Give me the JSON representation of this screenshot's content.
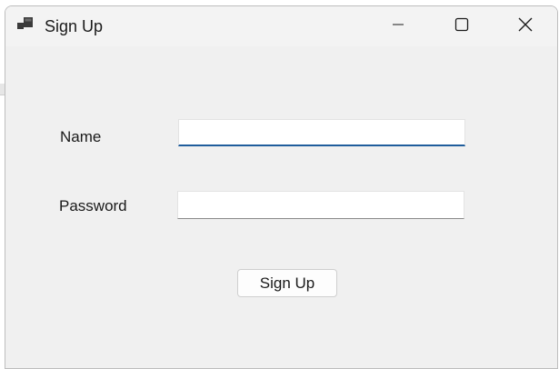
{
  "window": {
    "title": "Sign Up",
    "icon": "app-window-icon",
    "controls": {
      "minimize_icon": "minimize-icon",
      "maximize_icon": "maximize-icon",
      "close_icon": "close-icon"
    }
  },
  "form": {
    "name_label": "Name",
    "name_value": "",
    "password_label": "Password",
    "password_value": "",
    "submit_label": "Sign Up"
  },
  "colors": {
    "window_bg": "#f0f0f0",
    "focus_underline": "#1f5d9c",
    "input_bg": "#ffffff"
  }
}
